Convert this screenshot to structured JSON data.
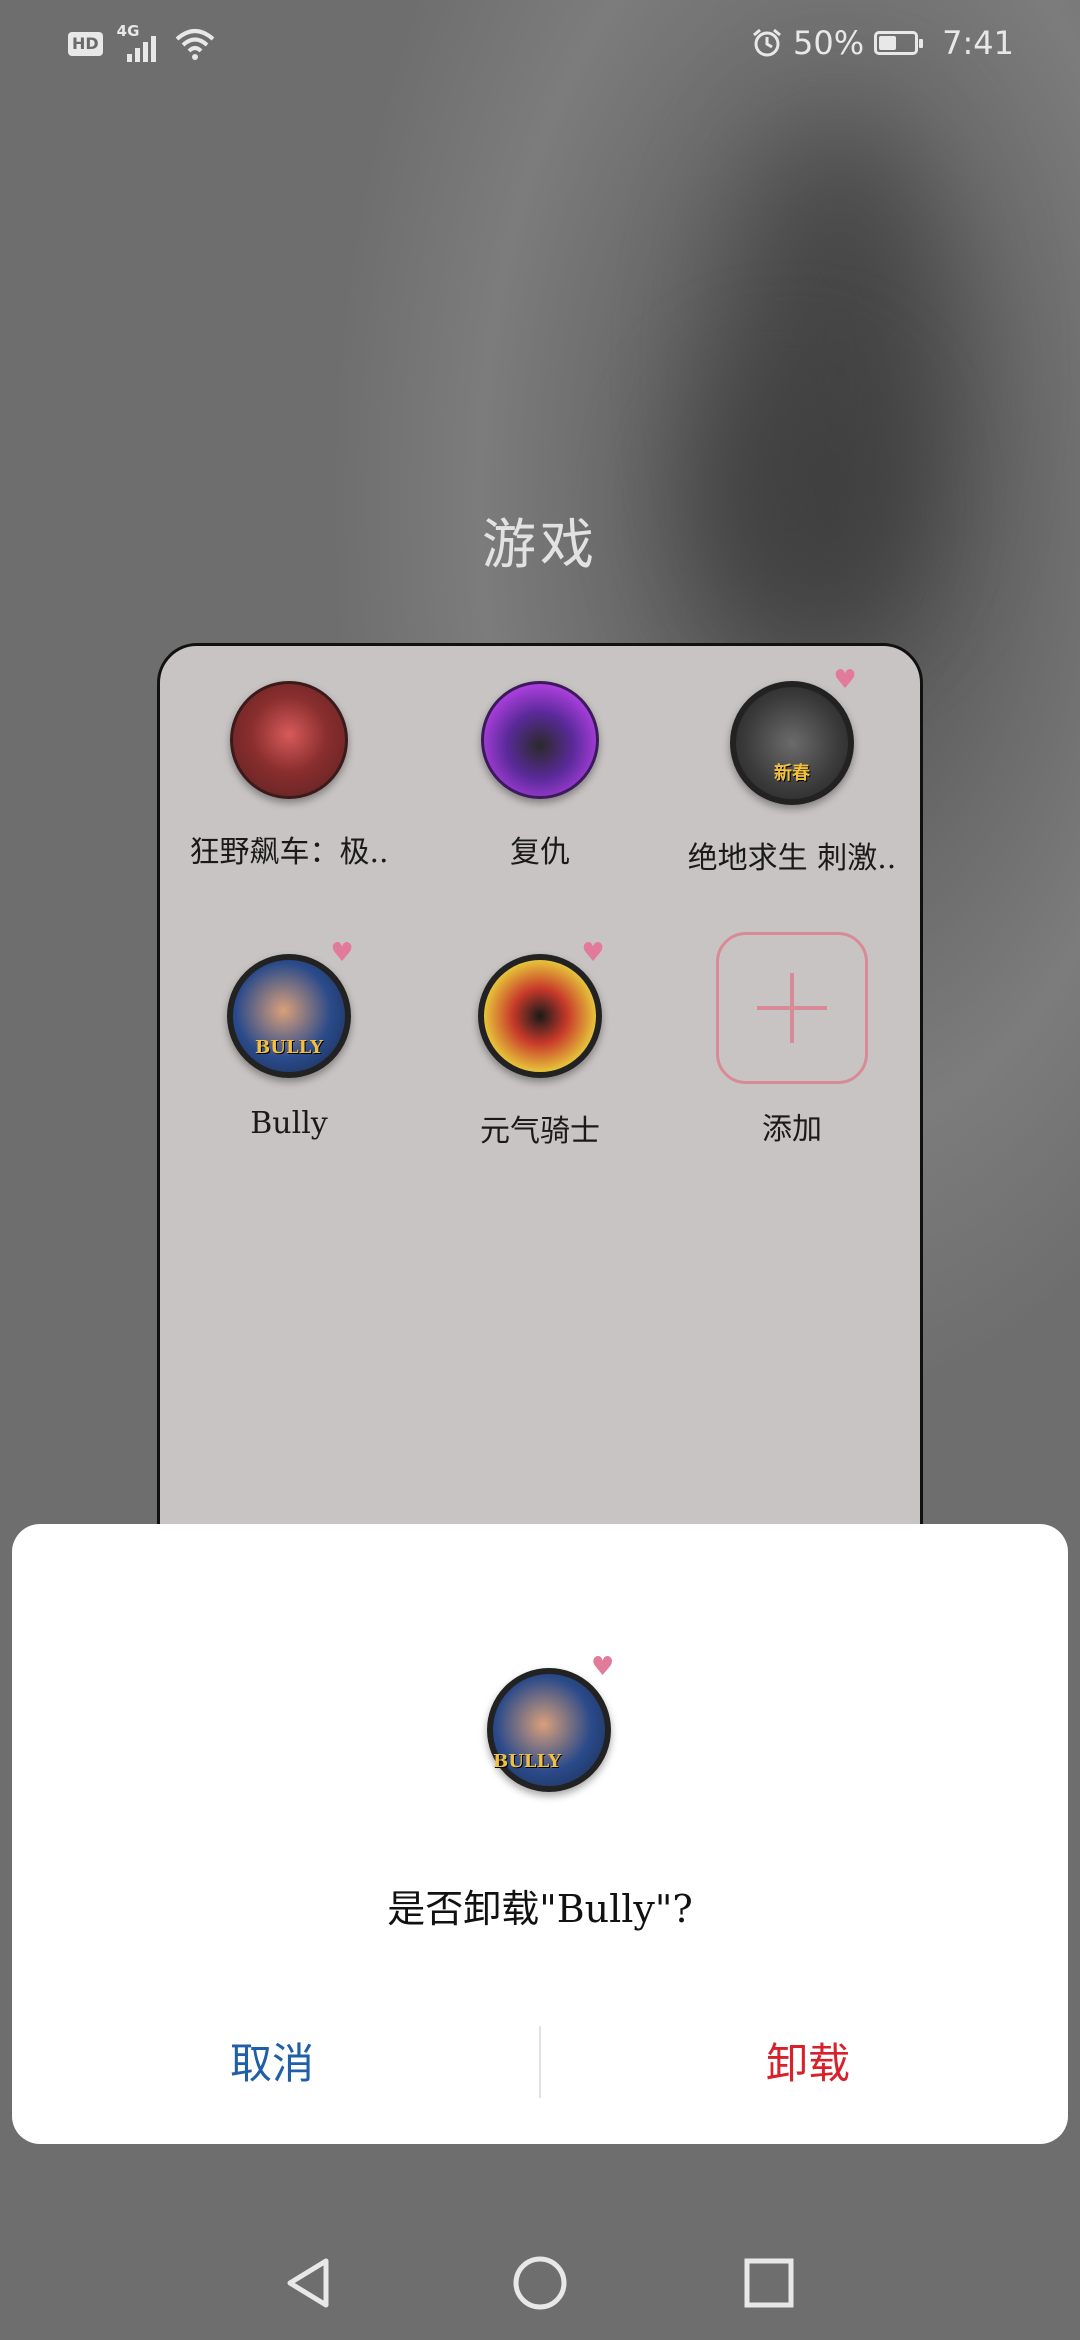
{
  "status_bar": {
    "hd": "HD",
    "network": "4G",
    "battery_percent": "50%",
    "battery_level": 0.5,
    "time": "7:41",
    "icons": [
      "hd-icon",
      "signal-icon",
      "wifi-icon",
      "alarm-icon",
      "battery-icon"
    ]
  },
  "folder": {
    "title": "游戏",
    "apps": [
      {
        "label": "狂野飙车：极..",
        "icon": "racing-game-icon"
      },
      {
        "label": "复仇",
        "icon": "revenge-game-icon"
      },
      {
        "label": "绝地求生 刺激..",
        "icon": "pubg-game-icon",
        "icon_text": "新春"
      },
      {
        "label": "Bully",
        "icon": "bully-game-icon",
        "icon_text": "BULLY"
      },
      {
        "label": "元气骑士",
        "icon": "soul-knight-game-icon"
      },
      {
        "label": "添加",
        "icon": "add-icon"
      }
    ]
  },
  "dialog": {
    "icon_text": "BULLY",
    "message": "是否卸载\"Bully\"?",
    "cancel_label": "取消",
    "confirm_label": "卸载"
  },
  "nav_bar": {
    "buttons": [
      "back-icon",
      "home-icon",
      "recents-icon"
    ]
  },
  "colors": {
    "cancel": "#1f5fa8",
    "confirm": "#d8212b",
    "folder_bg": "#c9c4c4",
    "add_accent": "#d98a98"
  }
}
